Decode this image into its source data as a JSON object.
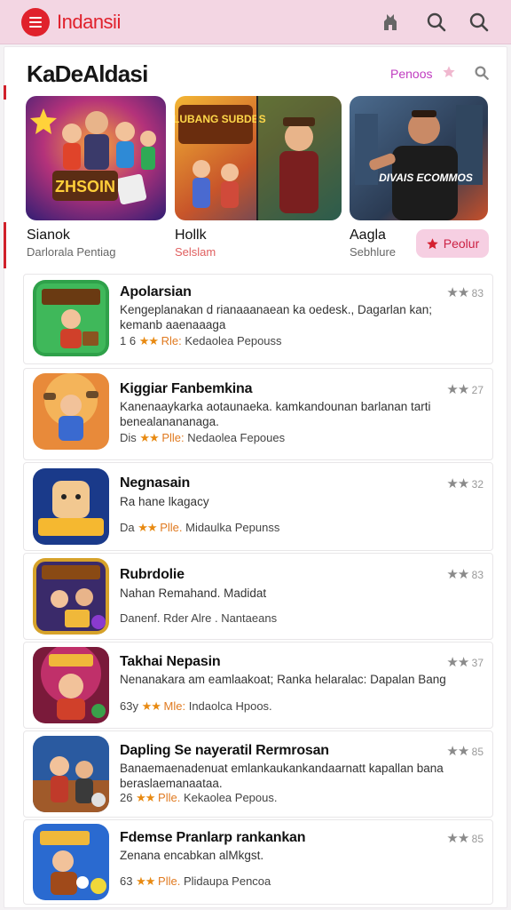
{
  "header": {
    "brand": "Indansii"
  },
  "section": {
    "title": "KaDeAldasi",
    "link": "Penoos"
  },
  "featured": [
    {
      "name": "Sianok",
      "subtitle": "Darlorala Pentiag",
      "art_title": "ZHSOIN"
    },
    {
      "name": "Hollk",
      "subtitle": "Selslam",
      "art_title": "BLUBANG SUBDES"
    },
    {
      "name": "Aagla",
      "subtitle": "Sebhlure",
      "art_title": "DIVAIS ECOMMOS"
    }
  ],
  "popular_button": {
    "label": "Peolur"
  },
  "apps": [
    {
      "title": "Apolarsian",
      "desc": "Kengeplanakan d rianaaanaean ka oedesk., Dagarlan kan; kemanb aaenaaaga",
      "meta_prefix": "1 6",
      "stars": "★★",
      "kind": "Rle:",
      "meta_suffix": "Kedaolea Pepouss",
      "rating": "83"
    },
    {
      "title": "Kiggiar Fanbemkina",
      "desc": "Kanenaaykarka aotaunaeka. kamkandounan barlanan tarti benealanananaga.",
      "meta_prefix": "Dis",
      "stars": "★★",
      "kind": "Plle:",
      "meta_suffix": "Nedaolea Fepoues",
      "rating": "27"
    },
    {
      "title": "Negnasain",
      "desc": "Ra hane lkagacy",
      "meta_prefix": "Da",
      "stars": "★★",
      "kind": "Plle.",
      "meta_suffix": "Midaulka Pepunss",
      "rating": "32"
    },
    {
      "title": "Rubrdolie",
      "desc": "Nahan Remahand. Madidat",
      "meta_prefix": "Danenf. Rder Alre .",
      "stars": "",
      "kind": "",
      "meta_suffix": "Nantaeans",
      "rating": "83"
    },
    {
      "title": "Takhai Nepasin",
      "desc": "Nenanakara am eamlaakoat; Ranka helaralac: Dapalan Bang",
      "meta_prefix": "63y",
      "stars": "★★",
      "kind": "Mle:",
      "meta_suffix": "Indaolca Hpoos.",
      "rating": "37"
    },
    {
      "title": "Dapling Se nayeratil Rermrosan",
      "desc": "Banaemaenadenuat emlankaukankandaarnatt kapallan bana beraslaemanaataa.",
      "meta_prefix": "26",
      "stars": "★★",
      "kind": "Plle.",
      "meta_suffix": "Kekaolea Pepous.",
      "rating": "85"
    },
    {
      "title": "Fdemse Pranlarp rankankan",
      "desc": "Zenana encabkan alMkgst.",
      "meta_prefix": "63",
      "stars": "★★",
      "kind": "Plle.",
      "meta_suffix": "Plidaupa Pencoa",
      "rating": "85"
    }
  ],
  "colors": {
    "brand_red": "#e0212c",
    "header_pink": "#f3d6e3",
    "accent_purple": "#c03cc0",
    "star_orange": "#e88a12"
  }
}
